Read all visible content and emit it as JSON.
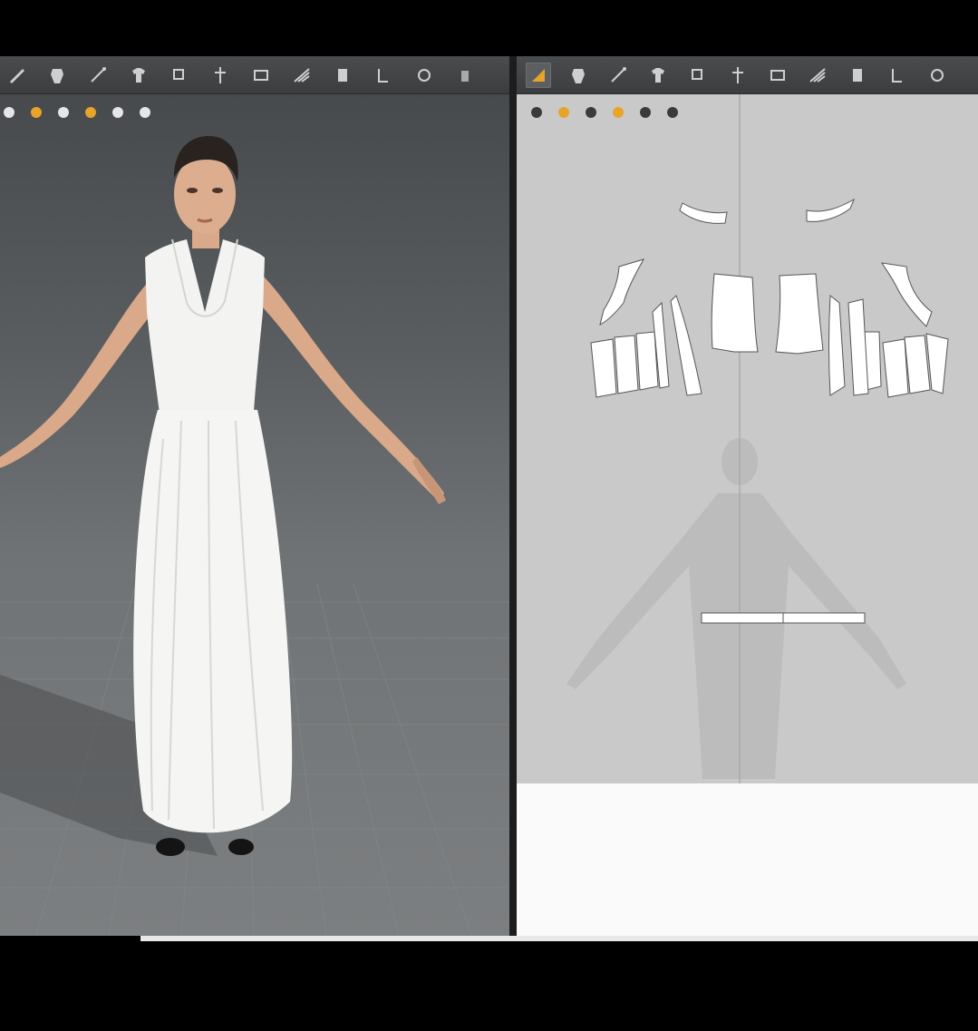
{
  "toolbar_3d": {
    "tools": [
      {
        "icon": "pencil-tool-icon"
      },
      {
        "icon": "garment-select-icon"
      },
      {
        "icon": "line-draw-icon"
      },
      {
        "icon": "shirt-icon"
      },
      {
        "icon": "select-move-icon"
      },
      {
        "icon": "pin-icon"
      },
      {
        "icon": "box-select-icon"
      },
      {
        "icon": "grid-fold-icon"
      },
      {
        "icon": "layer-icon"
      },
      {
        "icon": "tack-icon"
      },
      {
        "icon": "measure-icon"
      },
      {
        "icon": "avatar-tool-icon"
      }
    ]
  },
  "toolbar_2d": {
    "tools": [
      {
        "icon": "edit-pattern-icon",
        "active": true
      },
      {
        "icon": "transform-points-icon"
      },
      {
        "icon": "polygon-icon"
      },
      {
        "icon": "rectangle-icon"
      },
      {
        "icon": "add-point-icon"
      },
      {
        "icon": "curve-point-icon"
      },
      {
        "icon": "internal-line-icon"
      },
      {
        "icon": "dart-icon"
      },
      {
        "icon": "segment-sewing-icon"
      },
      {
        "icon": "free-sewing-icon"
      },
      {
        "icon": "pleat-icon"
      }
    ]
  },
  "view3d_icons": [
    "avatar-display-icon",
    "garment-display-icon",
    "fabric-render-icon",
    "skin-icon",
    "texture-icon",
    "export-icon"
  ],
  "view2d_icons": [
    "arrange-icon",
    "rotate-icon",
    "search-icon",
    "sun-icon",
    "fabric-icon",
    "export-icon"
  ],
  "colors": {
    "toolbar_bg": "#414345",
    "viewport_3d": "#6b6e70",
    "pattern_bg": "#c9c9c9",
    "pattern_piece": "#ffffff",
    "accent": "#e8a42a"
  }
}
